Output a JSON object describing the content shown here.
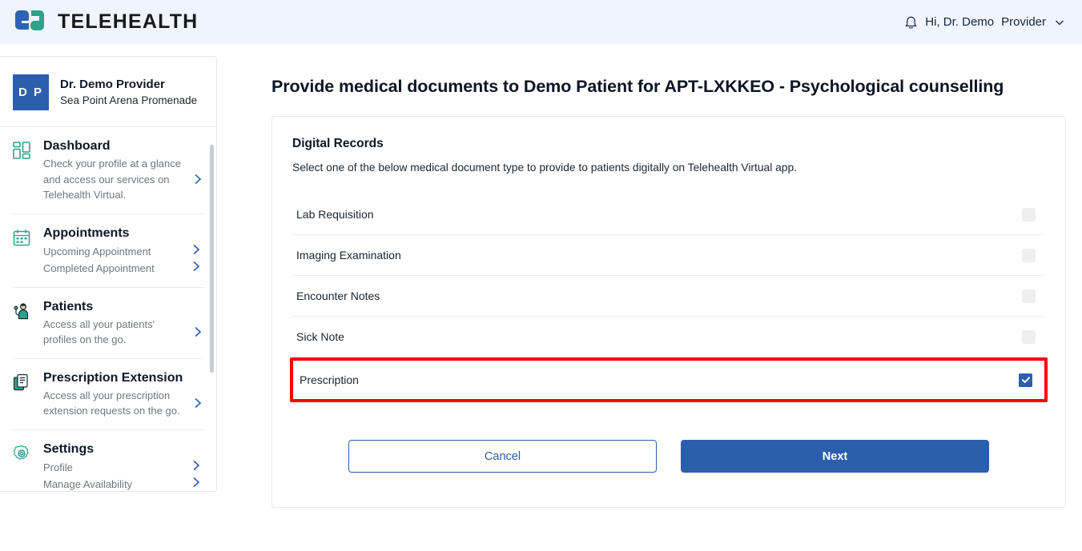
{
  "header": {
    "brand_name": "TELEHEALTH",
    "logo_icon": "telehealth-logo",
    "bell_icon": "notification-bell-icon",
    "greeting": "Hi, Dr. Demo",
    "role": "Provider",
    "chevron_icon": "chevron-down-icon",
    "colors": {
      "background": "#eff4fe",
      "accent": "#2b5fac",
      "logo_blue": "#2f62b3",
      "logo_teal": "#2ea18b"
    }
  },
  "sidebar": {
    "profile": {
      "initials": "D P",
      "name": "Dr. Demo Provider",
      "address": "Sea Point Arena Promenade"
    },
    "items": [
      {
        "icon": "dashboard-grid-icon",
        "title": "Dashboard",
        "description": "Check your profile at a glance and access our services on Telehealth Virtual.",
        "links": []
      },
      {
        "icon": "calendar-icon",
        "title": "Appointments",
        "description": "",
        "links": [
          "Upcoming Appointment",
          "Completed Appointment"
        ]
      },
      {
        "icon": "patients-icon",
        "title": "Patients",
        "description": "Access all your patients' profiles on the go.",
        "links": []
      },
      {
        "icon": "prescription-document-icon",
        "title": "Prescription Extension",
        "description": "Access all your prescription extension requests on the go.",
        "links": []
      },
      {
        "icon": "gear-icon",
        "title": "Settings",
        "description": "",
        "links": [
          "Profile",
          "Manage Availability"
        ]
      }
    ]
  },
  "main": {
    "page_title": "Provide medical documents to Demo Patient for APT-LXKKEO - Psychological counselling",
    "card": {
      "title": "Digital Records",
      "subtitle": "Select one of the below medical document type to provide to patients digitally on Telehealth Virtual app.",
      "options": [
        {
          "label": "Lab Requisition",
          "checked": false,
          "highlighted": false
        },
        {
          "label": "Imaging Examination",
          "checked": false,
          "highlighted": false
        },
        {
          "label": "Encounter Notes",
          "checked": false,
          "highlighted": false
        },
        {
          "label": "Sick Note",
          "checked": false,
          "highlighted": false
        },
        {
          "label": "Prescription",
          "checked": true,
          "highlighted": true
        }
      ],
      "highlight_color": "#ff0000",
      "buttons": {
        "cancel": "Cancel",
        "next": "Next"
      }
    }
  }
}
